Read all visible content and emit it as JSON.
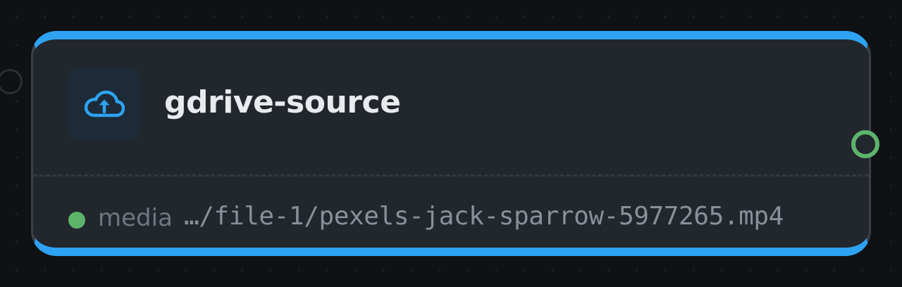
{
  "node": {
    "title": "gdrive-source",
    "icon": "cloud-upload-icon",
    "accent_color": "#2ea3f2",
    "output": {
      "type_label": "media",
      "value": "…/file-1/pexels-jack-sparrow-5977265.mp4",
      "status_color": "#5cb46b"
    }
  }
}
